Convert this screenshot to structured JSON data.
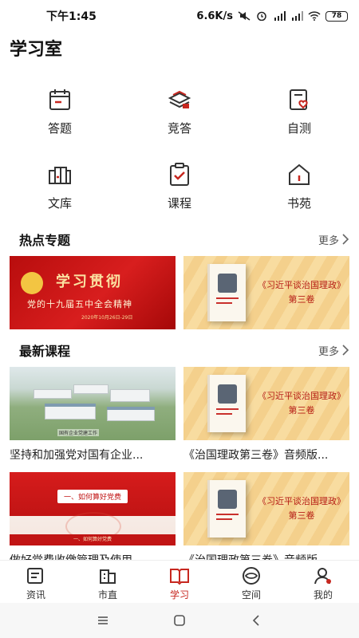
{
  "status": {
    "time": "下午1:45",
    "speed": "6.6K/s",
    "battery": "78",
    "icons": [
      "mute-icon",
      "alarm-icon",
      "signal-icon",
      "signal-icon",
      "wifi-icon",
      "battery-icon"
    ]
  },
  "page": {
    "title": "学习室"
  },
  "grid": [
    {
      "label": "答题",
      "icon": "calendar-icon"
    },
    {
      "label": "竞答",
      "icon": "books-icon"
    },
    {
      "label": "自测",
      "icon": "clipboard-heart-icon"
    },
    {
      "label": "文库",
      "icon": "library-icon"
    },
    {
      "label": "课程",
      "icon": "clipboard-check-icon"
    },
    {
      "label": "书苑",
      "icon": "house-icon"
    }
  ],
  "hot": {
    "title": "热点专题",
    "more": "更多",
    "banners": [
      {
        "big": "学习贯彻",
        "sub": "党的十九届五中全会精神",
        "meta": "2020年10月26日-29日"
      },
      {
        "text": "《习近平谈治国理政》第三卷"
      }
    ]
  },
  "latest": {
    "title": "最新课程",
    "more": "更多",
    "courses": [
      {
        "title": "坚持和加强党对国有企业...",
        "caption": "国有企业党建工作"
      },
      {
        "title": "《治国理政第三卷》音频版...",
        "banner_text": "《习近平谈治国理政》第三卷"
      },
      {
        "title": "做好党费收缴管理及使用...",
        "tag": "一、如何算好党费",
        "foot": "一、如何算好党费"
      },
      {
        "title": "《治国理政第三卷》音频版...",
        "banner_text": "《习近平谈治国理政》第三卷"
      }
    ]
  },
  "nav": [
    {
      "label": "资讯",
      "icon": "news-icon",
      "active": false
    },
    {
      "label": "市直",
      "icon": "building-icon",
      "active": false
    },
    {
      "label": "学习",
      "icon": "book-open-icon",
      "active": true
    },
    {
      "label": "空间",
      "icon": "eye-icon",
      "active": false
    },
    {
      "label": "我的",
      "icon": "user-icon",
      "active": false
    }
  ],
  "colors": {
    "accent": "#c7271f",
    "banner_red": "#d81e1e",
    "gold": "#f8dca0"
  }
}
